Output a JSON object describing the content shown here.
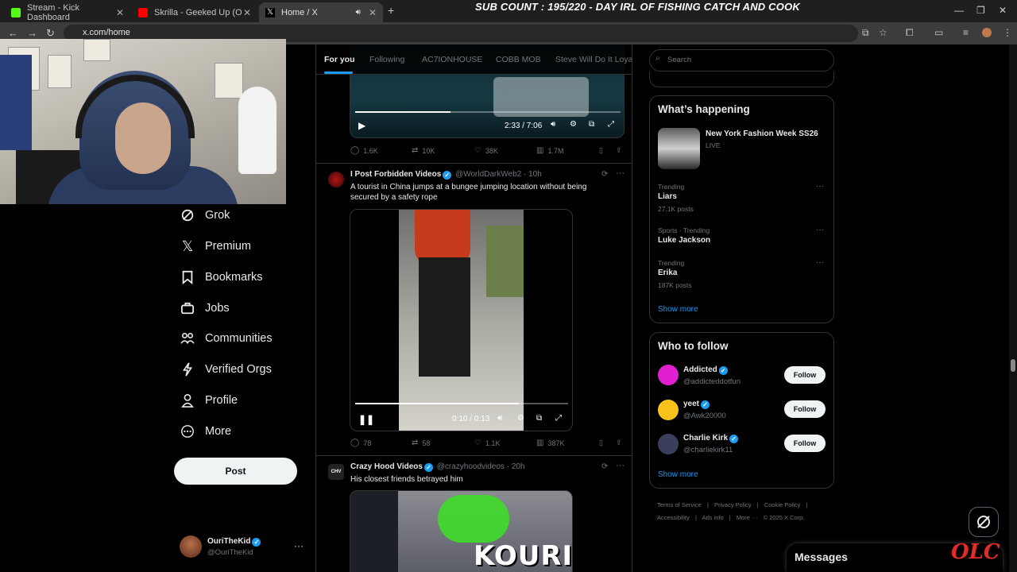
{
  "browser": {
    "tabs": [
      {
        "label": "Stream - Kick Dashboard",
        "favicon_color": "#53fc18"
      },
      {
        "label": "Skrilla - Geeked Up (Official Vid",
        "favicon_color": "#ff0000"
      },
      {
        "label": "Home / X",
        "favicon_color": "#ffffff"
      }
    ],
    "new_tab": "+",
    "url": "x.com/home"
  },
  "overlay_title": "SUB COUNT : 195/220 - DAY IRL OF FISHING CATCH AND COOK",
  "nav": {
    "items": [
      {
        "label": "Grok",
        "icon": "grok-icon"
      },
      {
        "label": "Premium",
        "icon": "x-logo-icon"
      },
      {
        "label": "Bookmarks",
        "icon": "bookmark-icon"
      },
      {
        "label": "Jobs",
        "icon": "briefcase-icon"
      },
      {
        "label": "Communities",
        "icon": "people-icon"
      },
      {
        "label": "Verified Orgs",
        "icon": "lightning-icon"
      },
      {
        "label": "Profile",
        "icon": "person-icon"
      },
      {
        "label": "More",
        "icon": "more-circle-icon"
      }
    ],
    "post_label": "Post",
    "account": {
      "name": "OuriTheKid",
      "handle": "@OuriTheKid"
    }
  },
  "feed": {
    "tabs": [
      "For you",
      "Following",
      "AC7IONHOUSE",
      "COBB MOB",
      "Steve Will Do It Loyal"
    ],
    "post0": {
      "time": "2:33 / 7:06",
      "progress": 0.36,
      "stats": {
        "replies": "1.6K",
        "reposts": "10K",
        "likes": "38K",
        "views": "1.7M"
      }
    },
    "post1": {
      "name": "I Post Forbidden Videos",
      "handle": "@WorldDarkWeb2 · 10h",
      "text": "A tourist in China jumps at a bungee jumping location without being secured by a safety rope",
      "time": "0:10 / 0:13",
      "progress": 0.77,
      "stats": {
        "replies": "78",
        "reposts": "58",
        "likes": "1.1K",
        "views": "387K"
      }
    },
    "post2": {
      "name": "Crazy Hood Videos",
      "handle": "@crazyhoodvideos · 20h",
      "text": "His closest friends betrayed him",
      "avatar_text": "CHV",
      "overlay_text": "KOURI"
    }
  },
  "right": {
    "search_placeholder": "Search",
    "happening": {
      "title": "What’s happening",
      "event": {
        "name": "New York Fashion Week SS26",
        "status": "LIVE"
      },
      "trends": [
        {
          "meta": "Trending",
          "name": "Liars",
          "posts": "27.1K posts"
        },
        {
          "meta": "Sports · Trending",
          "name": "Luke Jackson",
          "posts": ""
        },
        {
          "meta": "Trending",
          "name": "Erika",
          "posts": "187K posts"
        }
      ],
      "show_more": "Show more"
    },
    "who_to_follow": {
      "title": "Who to follow",
      "users": [
        {
          "name": "Addicted",
          "handle": "@addicteddotfun",
          "avatar_color": "#e11fd0"
        },
        {
          "name": "yeet",
          "handle": "@Awk20000",
          "avatar_color": "#f7c21b"
        },
        {
          "name": "Charlie Kirk",
          "handle": "@charliekirk11",
          "avatar_color": "#3a3f5c"
        }
      ],
      "follow_label": "Follow",
      "show_more": "Show more"
    },
    "footer": [
      "Terms of Service",
      "|",
      "Privacy Policy",
      "|",
      "Cookie Policy",
      "|",
      "Accessibility",
      "|",
      "Ads info",
      "|",
      "More ···",
      "© 2025 X Corp."
    ],
    "messages": "Messages"
  },
  "watermark": "OLC",
  "colors": {
    "accent": "#1d9bf0",
    "background": "#000000",
    "border": "#2f3336"
  }
}
